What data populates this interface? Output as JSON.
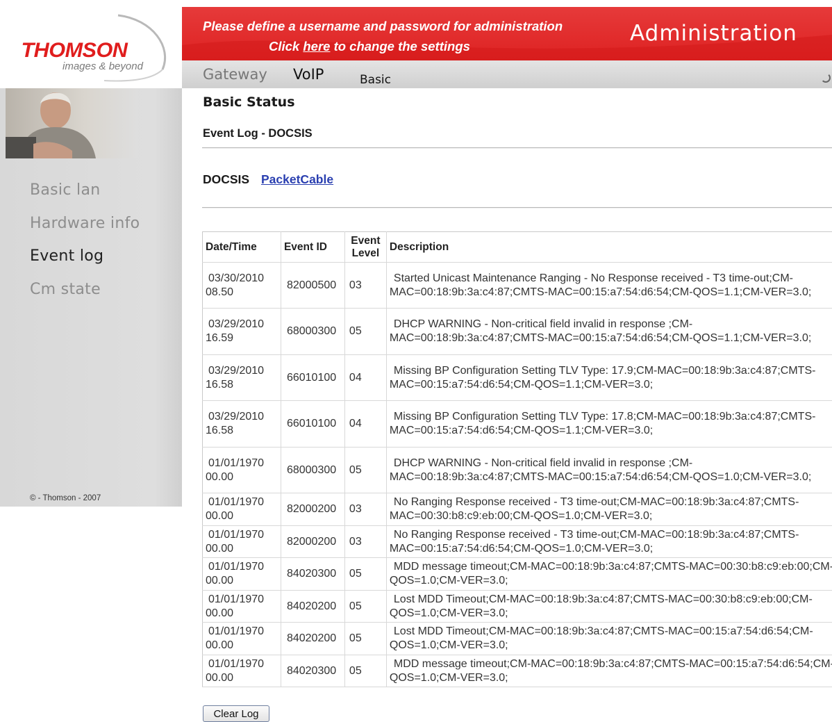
{
  "logo": {
    "brand": "THOMSON",
    "tagline": "images & beyond"
  },
  "sidebar": {
    "items": [
      {
        "label": "Basic lan",
        "active": false
      },
      {
        "label": "Hardware info",
        "active": false
      },
      {
        "label": "Event log",
        "active": true
      },
      {
        "label": "Cm state",
        "active": false
      }
    ],
    "copyright": "© - Thomson - 2007"
  },
  "banner": {
    "notice_line1": "Please define a username and password for administration",
    "notice_line2_prefix": "Click",
    "notice_link": "here",
    "notice_line2_suffix": "to change the settings",
    "title": "Administration"
  },
  "topnav": {
    "gateway": "Gateway",
    "voip": "VoIP",
    "basic": "Basic"
  },
  "main": {
    "title": "Basic Status",
    "subtitle": "Event Log - DOCSIS",
    "tabs": [
      {
        "label": "DOCSIS",
        "active": true
      },
      {
        "label": "PacketCable",
        "active": false
      }
    ],
    "table": {
      "columns": [
        "Date/Time",
        "Event ID",
        "Event Level",
        "Description"
      ],
      "rows": [
        {
          "date": "03/30/2010",
          "time": "08.50",
          "id": "82000500",
          "level": "03",
          "desc": "Started Unicast Maintenance Ranging - No Response received - T3 time-out;CM-MAC=00:18:9b:3a:c4:87;CMTS-MAC=00:15:a7:54:d6:54;CM-QOS=1.1;CM-VER=3.0;"
        },
        {
          "date": "03/29/2010",
          "time": "16.59",
          "id": "68000300",
          "level": "05",
          "desc": "DHCP WARNING - Non-critical field invalid in response ;CM-MAC=00:18:9b:3a:c4:87;CMTS-MAC=00:15:a7:54:d6:54;CM-QOS=1.1;CM-VER=3.0;"
        },
        {
          "date": "03/29/2010",
          "time": "16.58",
          "id": "66010100",
          "level": "04",
          "desc": "Missing BP Configuration Setting TLV Type: 17.9;CM-MAC=00:18:9b:3a:c4:87;CMTS-MAC=00:15:a7:54:d6:54;CM-QOS=1.1;CM-VER=3.0;"
        },
        {
          "date": "03/29/2010",
          "time": "16.58",
          "id": "66010100",
          "level": "04",
          "desc": "Missing BP Configuration Setting TLV Type: 17.8;CM-MAC=00:18:9b:3a:c4:87;CMTS-MAC=00:15:a7:54:d6:54;CM-QOS=1.1;CM-VER=3.0;"
        },
        {
          "date": "01/01/1970",
          "time": "00.00",
          "id": "68000300",
          "level": "05",
          "desc": "DHCP WARNING - Non-critical field invalid in response ;CM-MAC=00:18:9b:3a:c4:87;CMTS-MAC=00:15:a7:54:d6:54;CM-QOS=1.0;CM-VER=3.0;"
        },
        {
          "date": "01/01/1970",
          "time": "00.00",
          "id": "82000200",
          "level": "03",
          "desc": "No Ranging Response received - T3 time-out;CM-MAC=00:18:9b:3a:c4:87;CMTS-MAC=00:30:b8:c9:eb:00;CM-QOS=1.0;CM-VER=3.0;"
        },
        {
          "date": "01/01/1970",
          "time": "00.00",
          "id": "82000200",
          "level": "03",
          "desc": "No Ranging Response received - T3 time-out;CM-MAC=00:18:9b:3a:c4:87;CMTS-MAC=00:15:a7:54:d6:54;CM-QOS=1.0;CM-VER=3.0;"
        },
        {
          "date": "01/01/1970",
          "time": "00.00",
          "id": "84020300",
          "level": "05",
          "desc": "MDD message timeout;CM-MAC=00:18:9b:3a:c4:87;CMTS-MAC=00:30:b8:c9:eb:00;CM-QOS=1.0;CM-VER=3.0;"
        },
        {
          "date": "01/01/1970",
          "time": "00.00",
          "id": "84020200",
          "level": "05",
          "desc": "Lost MDD Timeout;CM-MAC=00:18:9b:3a:c4:87;CMTS-MAC=00:30:b8:c9:eb:00;CM-QOS=1.0;CM-VER=3.0;"
        },
        {
          "date": "01/01/1970",
          "time": "00.00",
          "id": "84020200",
          "level": "05",
          "desc": "Lost MDD Timeout;CM-MAC=00:18:9b:3a:c4:87;CMTS-MAC=00:15:a7:54:d6:54;CM-QOS=1.0;CM-VER=3.0;"
        },
        {
          "date": "01/01/1970",
          "time": "00.00",
          "id": "84020300",
          "level": "05",
          "desc": "MDD message timeout;CM-MAC=00:18:9b:3a:c4:87;CMTS-MAC=00:15:a7:54:d6:54;CM-QOS=1.0;CM-VER=3.0;"
        }
      ]
    },
    "clear_button": "Clear Log"
  },
  "colors": {
    "banner_red": "#de2222",
    "link_blue": "#2a3fb0",
    "sidebar_gray": "#dedede"
  },
  "icons": [
    "logo-swoosh-icon",
    "user-photo",
    "loading-spinner-icon"
  ]
}
